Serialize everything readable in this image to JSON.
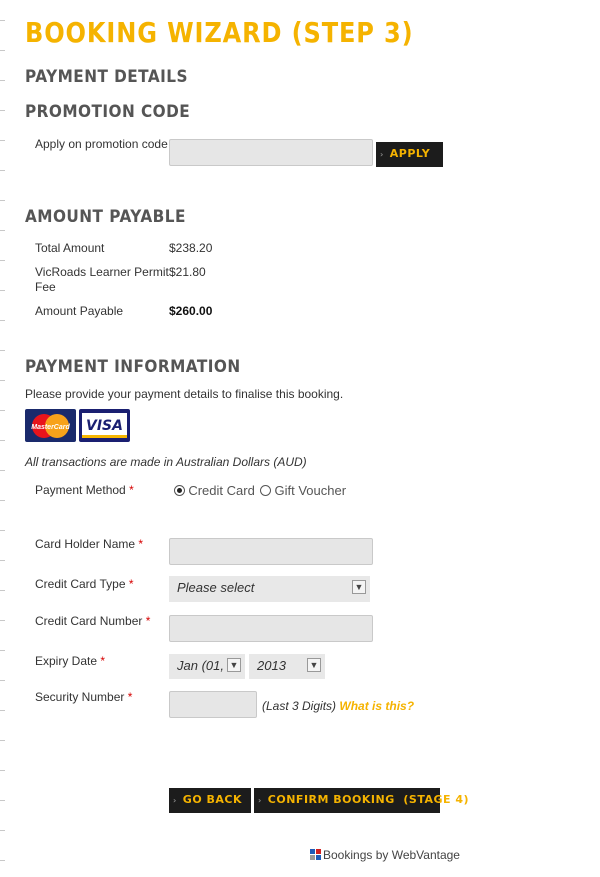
{
  "wizard": {
    "title": "BOOKING WIZARD (STEP 3)",
    "payment_details_heading": "PAYMENT DETAILS"
  },
  "promotion": {
    "heading": "PROMOTION CODE",
    "label": "Apply on promotion code",
    "code_value": "",
    "apply_label": "APPLY"
  },
  "amount": {
    "heading": "AMOUNT PAYABLE",
    "rows": [
      {
        "label": "Total Amount",
        "value": "$238.20"
      },
      {
        "label_line1": "VicRoads Learner Permit",
        "label_line2": "Fee",
        "value": "$21.80"
      },
      {
        "label": "Amount Payable",
        "value": "$260.00"
      }
    ]
  },
  "payment": {
    "heading": "PAYMENT INFORMATION",
    "intro": "Please provide your payment details to finalise this booking.",
    "card_logos": [
      "MasterCard",
      "VISA"
    ],
    "currency_note": "All transactions are made in Australian Dollars (AUD)",
    "method_label": "Payment Method",
    "required_mark": "*",
    "method_options": [
      "Credit Card",
      "Gift Voucher"
    ],
    "selected_method": "Credit Card",
    "card_holder_label": "Card Holder Name",
    "card_holder_value": "",
    "card_type_label": "Credit Card Type",
    "card_type_value": "Please select",
    "card_number_label": "Credit Card Number",
    "card_number_value": "",
    "expiry_label": "Expiry Date",
    "expiry_month": "Jan (01,",
    "expiry_year": "2013",
    "security_label": "Security Number",
    "security_value": "",
    "security_hint": "(Last 3 Digits)",
    "security_link": "What is this?"
  },
  "actions": {
    "back_label": "GO BACK",
    "confirm_label": "CONFIRM BOOKING  (STAGE 4)"
  },
  "footer": {
    "credit": "Bookings by WebVantage",
    "icon": "webvantage-logo-icon"
  },
  "colors": {
    "accent": "#f5b300",
    "button_bg": "#1c1c1c",
    "heading_gray": "#555555",
    "required": "#d60000"
  }
}
